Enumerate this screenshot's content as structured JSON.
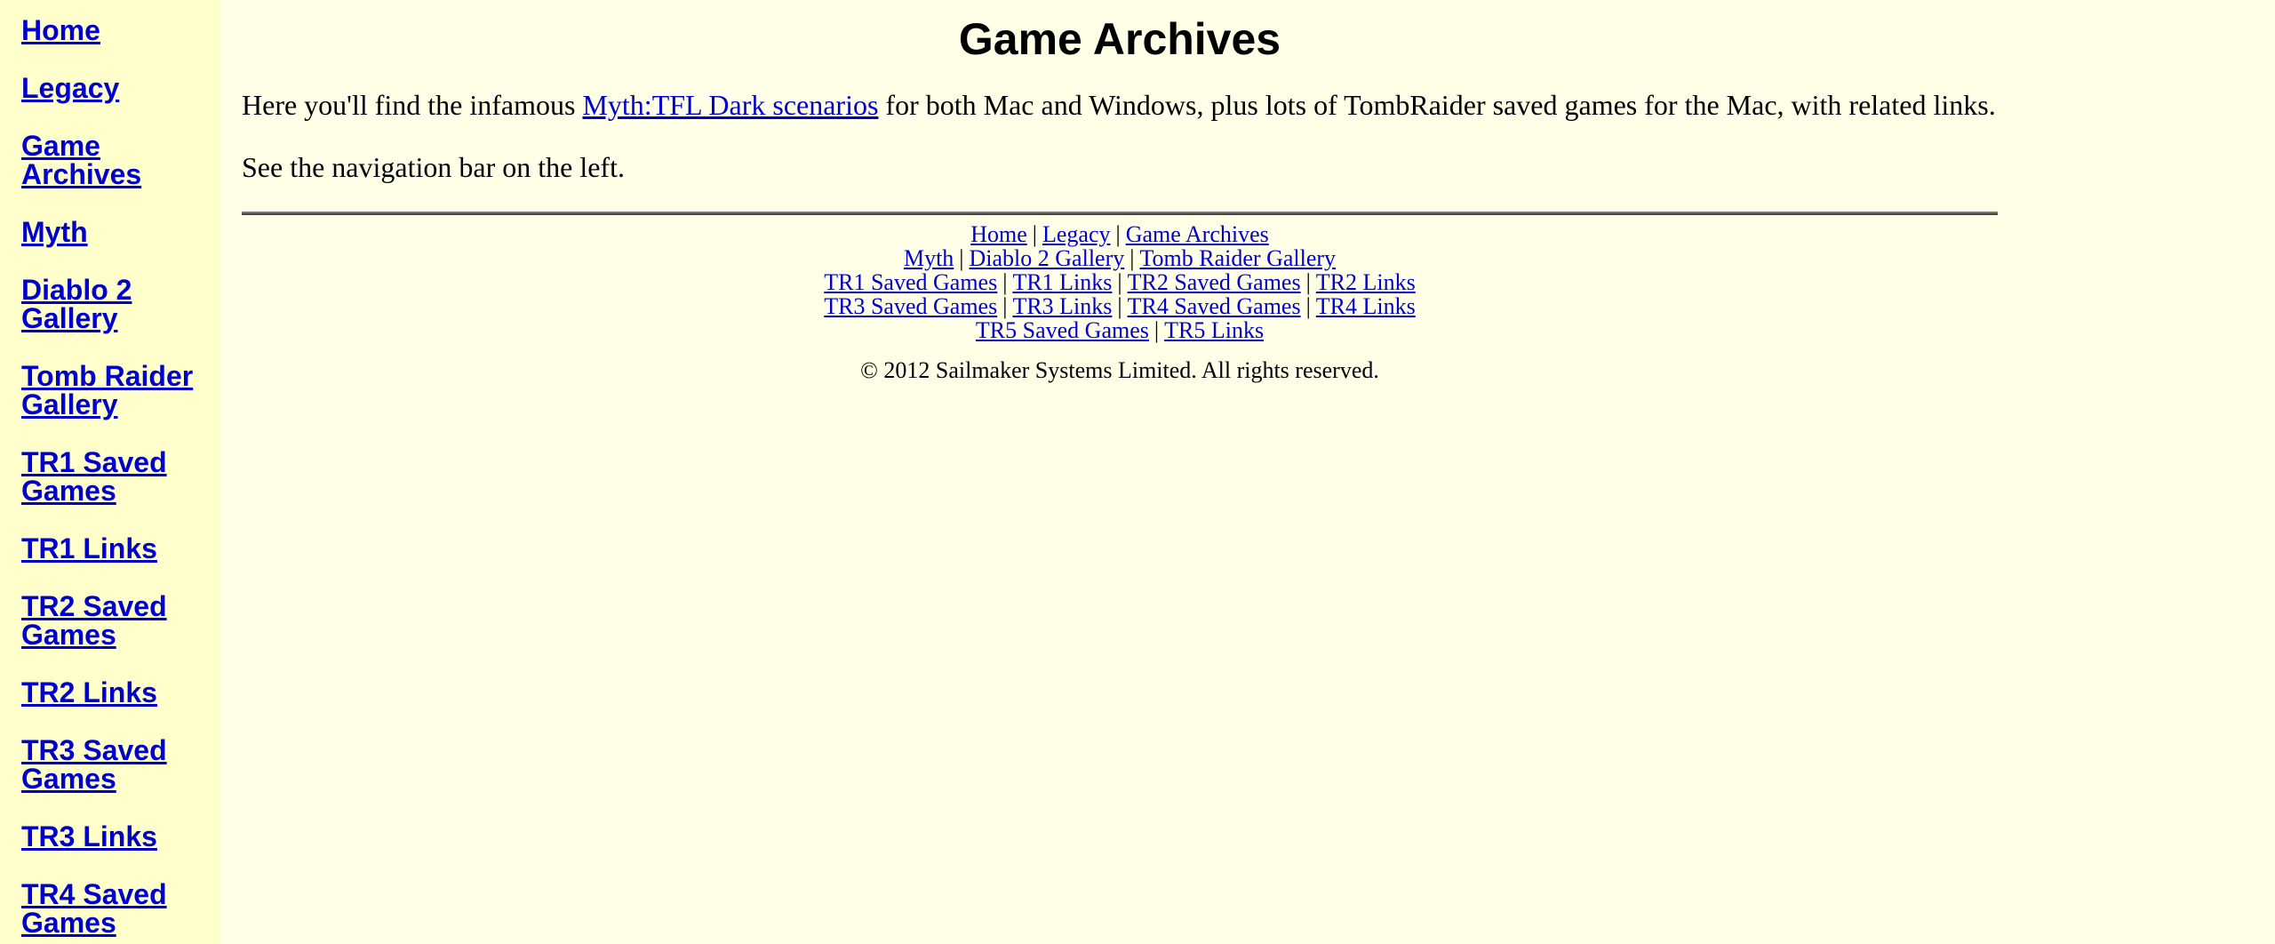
{
  "sidebar": {
    "items": [
      {
        "label": "Home"
      },
      {
        "label": "Legacy"
      },
      {
        "label": "Game Archives"
      },
      {
        "label": "Myth"
      },
      {
        "label": "Diablo 2 Gallery"
      },
      {
        "label": "Tomb Raider Gallery"
      },
      {
        "label": "TR1 Saved Games"
      },
      {
        "label": "TR1 Links"
      },
      {
        "label": "TR2 Saved Games"
      },
      {
        "label": "TR2 Links"
      },
      {
        "label": "TR3 Saved Games"
      },
      {
        "label": "TR3 Links"
      },
      {
        "label": "TR4 Saved Games"
      }
    ]
  },
  "main": {
    "title": "Game Archives",
    "intro_before": "Here you'll find the infamous ",
    "intro_link": "Myth:TFL Dark scenarios",
    "intro_after": " for both Mac and Windows, plus lots of TombRaider saved games for the Mac, with related links.",
    "nav_note": "See the navigation bar on the left."
  },
  "footer": {
    "separator": "|",
    "rows": [
      [
        "Home",
        "Legacy",
        "Game Archives"
      ],
      [
        "Myth",
        "Diablo 2 Gallery",
        "Tomb Raider Gallery"
      ],
      [
        "TR1 Saved Games",
        "TR1 Links",
        "TR2 Saved Games",
        "TR2 Links"
      ],
      [
        "TR3 Saved Games",
        "TR3 Links",
        "TR4 Saved Games",
        "TR4 Links"
      ],
      [
        "TR5 Saved Games",
        "TR5 Links"
      ]
    ],
    "copyright": "© 2012 Sailmaker Systems Limited. All rights reserved."
  },
  "colors": {
    "page_background": "#ffffe8",
    "sidebar_background": "#ffffcc",
    "link": "#0000cc"
  }
}
